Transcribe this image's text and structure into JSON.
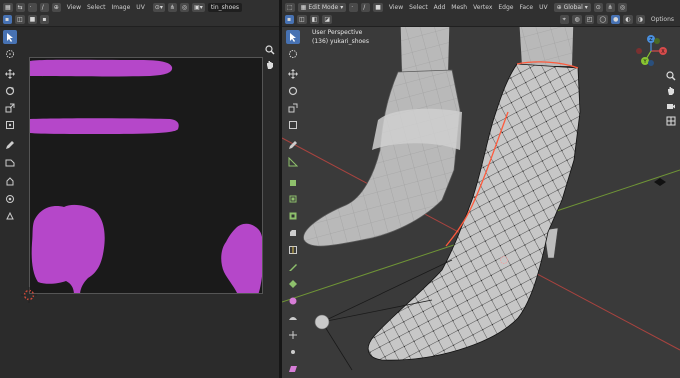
{
  "uv_editor": {
    "header": {
      "menus": [
        "View",
        "Select",
        "Image",
        "UV"
      ],
      "image_name": "tin_shoes"
    },
    "colors": {
      "paint": "#b547c9",
      "background": "#1a1a1a"
    }
  },
  "viewport": {
    "header": {
      "mode": "Edit Mode",
      "menus": [
        "View",
        "Select",
        "Add",
        "Mesh",
        "Vertex",
        "Edge",
        "Face",
        "UV"
      ],
      "orientation": "Global",
      "options": "Options"
    },
    "overlay": {
      "line1": "User Perspective",
      "line2": "(136) yukari_shoes"
    },
    "gizmo": {
      "x": "X",
      "y": "Y",
      "z": "Z"
    },
    "colors": {
      "axis_x": "#d64b4b",
      "axis_y": "#88c431",
      "axis_z": "#4a8fde",
      "selected_edge": "#ff5a3c",
      "mesh": "#c8c8c8"
    }
  }
}
